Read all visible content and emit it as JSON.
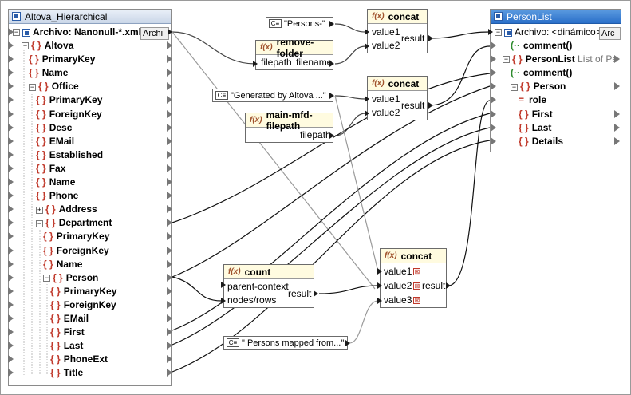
{
  "source": {
    "title": "Altova_Hierarchical",
    "file_label": "Archivo: Nanonull-*.xml",
    "file_button": "Archi",
    "items": [
      {
        "label": "Altova",
        "kind": "element",
        "expander": "−"
      },
      {
        "label": "PrimaryKey",
        "kind": "element"
      },
      {
        "label": "Name",
        "kind": "element"
      },
      {
        "label": "Office",
        "kind": "element",
        "expander": "−"
      },
      {
        "label": "PrimaryKey",
        "kind": "element"
      },
      {
        "label": "ForeignKey",
        "kind": "element"
      },
      {
        "label": "Desc",
        "kind": "element"
      },
      {
        "label": "EMail",
        "kind": "element"
      },
      {
        "label": "Established",
        "kind": "element"
      },
      {
        "label": "Fax",
        "kind": "element"
      },
      {
        "label": "Name",
        "kind": "element"
      },
      {
        "label": "Phone",
        "kind": "element"
      },
      {
        "label": "Address",
        "kind": "element",
        "expander": "+"
      },
      {
        "label": "Department",
        "kind": "element",
        "expander": "−"
      },
      {
        "label": "PrimaryKey",
        "kind": "element"
      },
      {
        "label": "ForeignKey",
        "kind": "element"
      },
      {
        "label": "Name",
        "kind": "element"
      },
      {
        "label": "Person",
        "kind": "element",
        "expander": "−"
      },
      {
        "label": "PrimaryKey",
        "kind": "element"
      },
      {
        "label": "ForeignKey",
        "kind": "element"
      },
      {
        "label": "EMail",
        "kind": "element"
      },
      {
        "label": "First",
        "kind": "element"
      },
      {
        "label": "Last",
        "kind": "element"
      },
      {
        "label": "PhoneExt",
        "kind": "element"
      },
      {
        "label": "Title",
        "kind": "element"
      }
    ]
  },
  "target": {
    "title": "PersonList",
    "file_label": "Archivo: <dinámico>",
    "file_button": "Arc",
    "items": [
      {
        "label": "comment()",
        "kind": "comment"
      },
      {
        "label": "PersonList",
        "kind": "element",
        "expander": "−",
        "suffix": "List of Pe"
      },
      {
        "label": "comment()",
        "kind": "comment"
      },
      {
        "label": "Person",
        "kind": "element",
        "expander": "−"
      },
      {
        "label": "role",
        "kind": "attribute"
      },
      {
        "label": "First",
        "kind": "element"
      },
      {
        "label": "Last",
        "kind": "element"
      },
      {
        "label": "Details",
        "kind": "element"
      }
    ]
  },
  "constants": {
    "persons": "\"Persons-\"",
    "generated": "\"Generated by Altova ...\"",
    "mapped": "\" Persons mapped from...\"",
    "icon": "C≡"
  },
  "functions": {
    "fn_icon": "f(x)",
    "concat1": {
      "title": "concat",
      "in1": "value1",
      "in2": "value2",
      "out": "result"
    },
    "remove_folder": {
      "title": "remove-folder",
      "in1": "filepath",
      "out": "filename"
    },
    "concat2": {
      "title": "concat",
      "in1": "value1",
      "in2": "value2",
      "out": "result"
    },
    "main_mfd": {
      "title": "main-mfd-filepath",
      "out": "filepath"
    },
    "count": {
      "title": "count",
      "in1": "parent-context",
      "in2": "nodes/rows",
      "out": "result"
    },
    "concat3": {
      "title": "concat",
      "in1": "value1",
      "in2": "value2",
      "in3": "value3",
      "out": "result",
      "remove_mark": "⊠"
    }
  }
}
